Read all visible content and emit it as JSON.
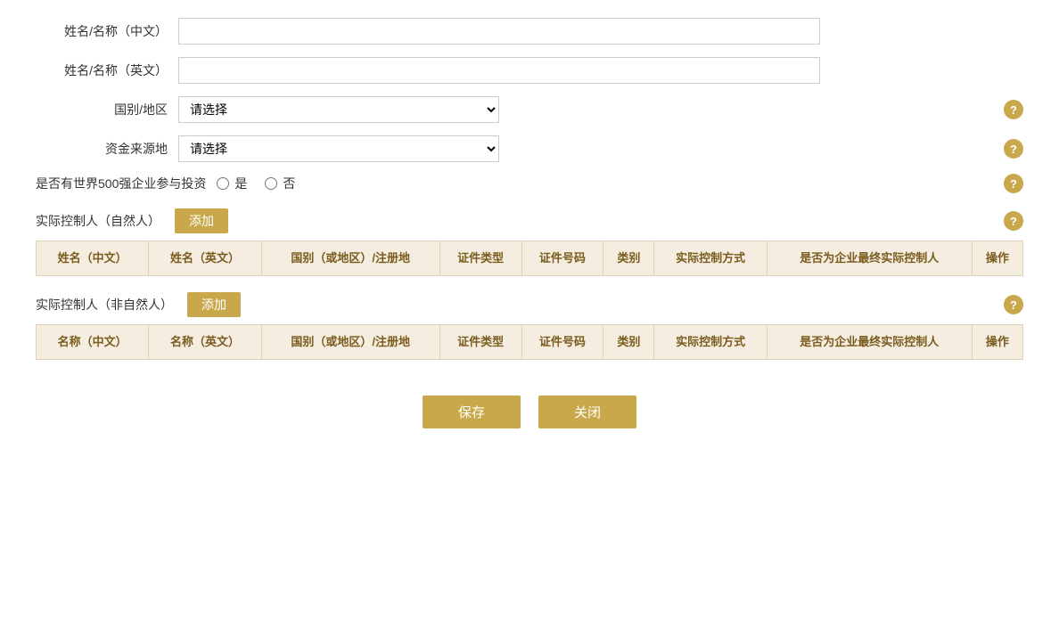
{
  "form": {
    "name_cn_label": "姓名/名称（中文）",
    "name_cn_placeholder": "",
    "name_en_label": "姓名/名称（英文）",
    "name_en_placeholder": "",
    "country_label": "国别/地区",
    "country_placeholder": "请选择",
    "fund_source_label": "资金来源地",
    "fund_source_placeholder": "请选择",
    "fortune500_label": "是否有世界500强企业参与投资",
    "fortune500_yes": "是",
    "fortune500_no": "否"
  },
  "natural_person_section": {
    "title": "实际控制人（自然人）",
    "add_label": "添加",
    "help": "?",
    "columns": [
      "姓名（中文）",
      "姓名（英文）",
      "国别（或地区）/注册地",
      "证件类型",
      "证件号码",
      "类别",
      "实际控制方式",
      "是否为企业最终实际控制人",
      "操作"
    ]
  },
  "non_natural_person_section": {
    "title": "实际控制人（非自然人）",
    "add_label": "添加",
    "help": "?",
    "columns": [
      "名称（中文）",
      "名称（英文）",
      "国别（或地区）/注册地",
      "证件类型",
      "证件号码",
      "类别",
      "实际控制方式",
      "是否为企业最终实际控制人",
      "操作"
    ]
  },
  "actions": {
    "save": "保存",
    "close": "关闭"
  },
  "help_icon": "?",
  "colors": {
    "gold": "#c8a84b",
    "table_header_bg": "#f5ede0",
    "table_border": "#e0d0b8",
    "header_text": "#7a5c1e"
  }
}
